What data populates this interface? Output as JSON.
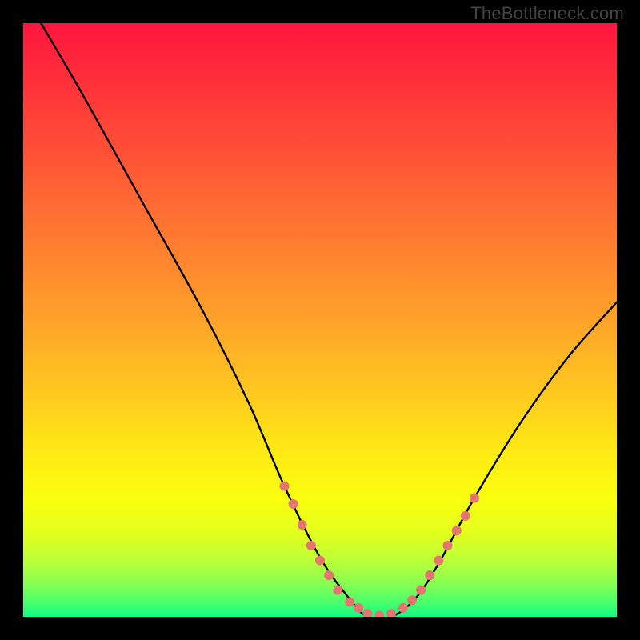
{
  "watermark": "TheBottleneck.com",
  "chart_data": {
    "type": "line",
    "title": "",
    "xlabel": "",
    "ylabel": "",
    "xlim": [
      0,
      100
    ],
    "ylim": [
      0,
      100
    ],
    "series": [
      {
        "name": "bottleneck-curve",
        "x": [
          3,
          10,
          20,
          30,
          38,
          44,
          50,
          55,
          58,
          62,
          66,
          70,
          76,
          84,
          92,
          100
        ],
        "y": [
          100,
          88,
          70,
          52,
          36,
          22,
          10,
          3,
          0,
          0,
          3,
          9,
          20,
          33,
          44,
          53
        ]
      }
    ],
    "marker_cluster": {
      "name": "highlight-dots",
      "color": "#e4766f",
      "points": [
        {
          "x": 44,
          "y": 22
        },
        {
          "x": 45.5,
          "y": 19
        },
        {
          "x": 47,
          "y": 15.5
        },
        {
          "x": 48.5,
          "y": 12
        },
        {
          "x": 50,
          "y": 9.5
        },
        {
          "x": 51.5,
          "y": 7
        },
        {
          "x": 53,
          "y": 4.5
        },
        {
          "x": 55,
          "y": 2.5
        },
        {
          "x": 56.5,
          "y": 1.5
        },
        {
          "x": 58,
          "y": 0.5
        },
        {
          "x": 60,
          "y": 0.2
        },
        {
          "x": 62,
          "y": 0.5
        },
        {
          "x": 64,
          "y": 1.5
        },
        {
          "x": 65.5,
          "y": 2.8
        },
        {
          "x": 67,
          "y": 4.5
        },
        {
          "x": 68.5,
          "y": 7
        },
        {
          "x": 70,
          "y": 9.5
        },
        {
          "x": 71.5,
          "y": 12
        },
        {
          "x": 73,
          "y": 14.5
        },
        {
          "x": 74.5,
          "y": 17
        },
        {
          "x": 76,
          "y": 20
        }
      ]
    },
    "gradient_stops": [
      {
        "pos": 0.0,
        "color": "#ff163e"
      },
      {
        "pos": 0.5,
        "color": "#ffa229"
      },
      {
        "pos": 0.8,
        "color": "#faff0e"
      },
      {
        "pos": 1.0,
        "color": "#11ff85"
      }
    ]
  }
}
